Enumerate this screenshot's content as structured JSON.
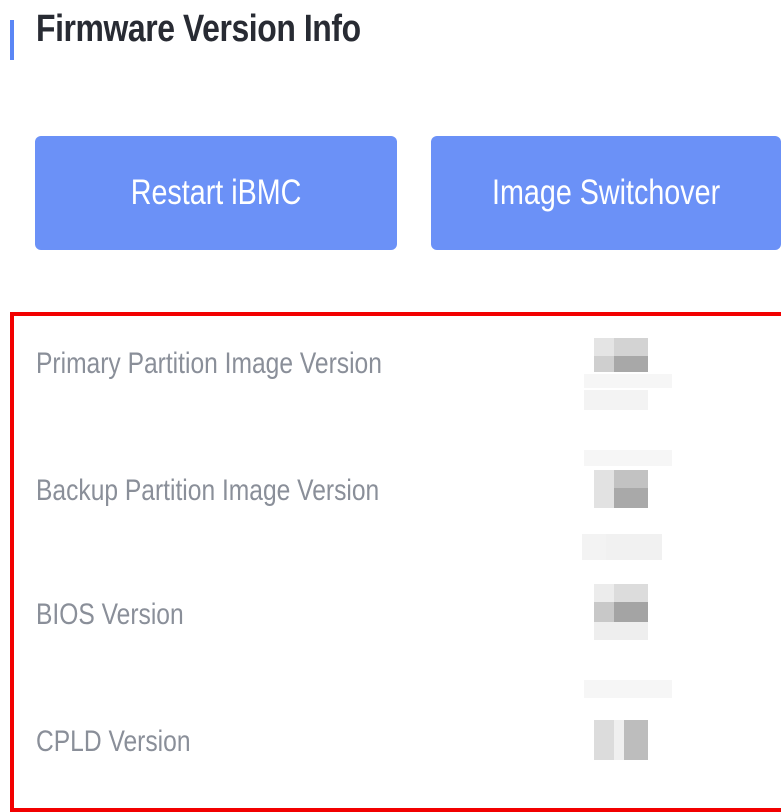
{
  "header": {
    "title": "Firmware Version Info"
  },
  "actions": {
    "restart_label": "Restart iBMC",
    "switchover_label": "Image Switchover"
  },
  "versions": [
    {
      "label": "Primary Partition Image Version",
      "value_redacted": true
    },
    {
      "label": "Backup Partition Image Version",
      "value_redacted": true
    },
    {
      "label": "BIOS Version",
      "value_redacted": true
    },
    {
      "label": "CPLD Version",
      "value_redacted": true
    }
  ],
  "colors": {
    "accent": "#5b86f5",
    "button": "#6b91f7",
    "highlight": "#f20000",
    "label_text": "#8a8f99",
    "title_text": "#282b33"
  }
}
